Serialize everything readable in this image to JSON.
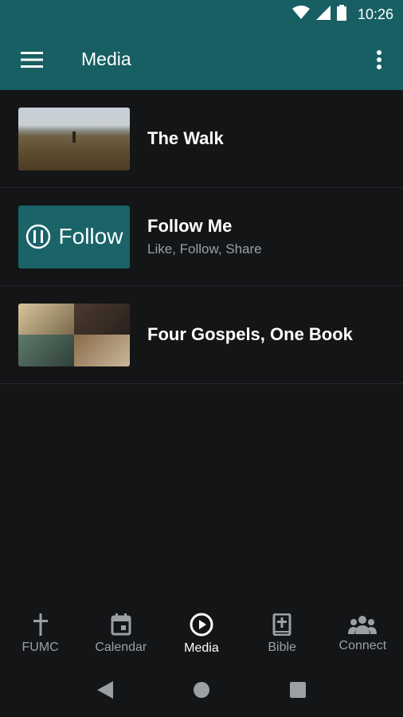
{
  "status_bar": {
    "time": "10:26"
  },
  "app_bar": {
    "title": "Media"
  },
  "media_items": [
    {
      "title": "The Walk",
      "subtitle": ""
    },
    {
      "title": "Follow Me",
      "subtitle": "Like, Follow, Share",
      "thumb_text": "Follow"
    },
    {
      "title": "Four Gospels, One Book",
      "subtitle": ""
    }
  ],
  "bottom_nav": {
    "items": [
      {
        "label": "FUMC",
        "icon": "cross-icon",
        "active": false
      },
      {
        "label": "Calendar",
        "icon": "calendar-icon",
        "active": false
      },
      {
        "label": "Media",
        "icon": "play-circle-icon",
        "active": true
      },
      {
        "label": "Bible",
        "icon": "bible-icon",
        "active": false
      },
      {
        "label": "Connect",
        "icon": "people-icon",
        "active": false
      }
    ]
  },
  "colors": {
    "accent": "#175f63",
    "background": "#141517",
    "inactive": "#9aa0a4"
  }
}
